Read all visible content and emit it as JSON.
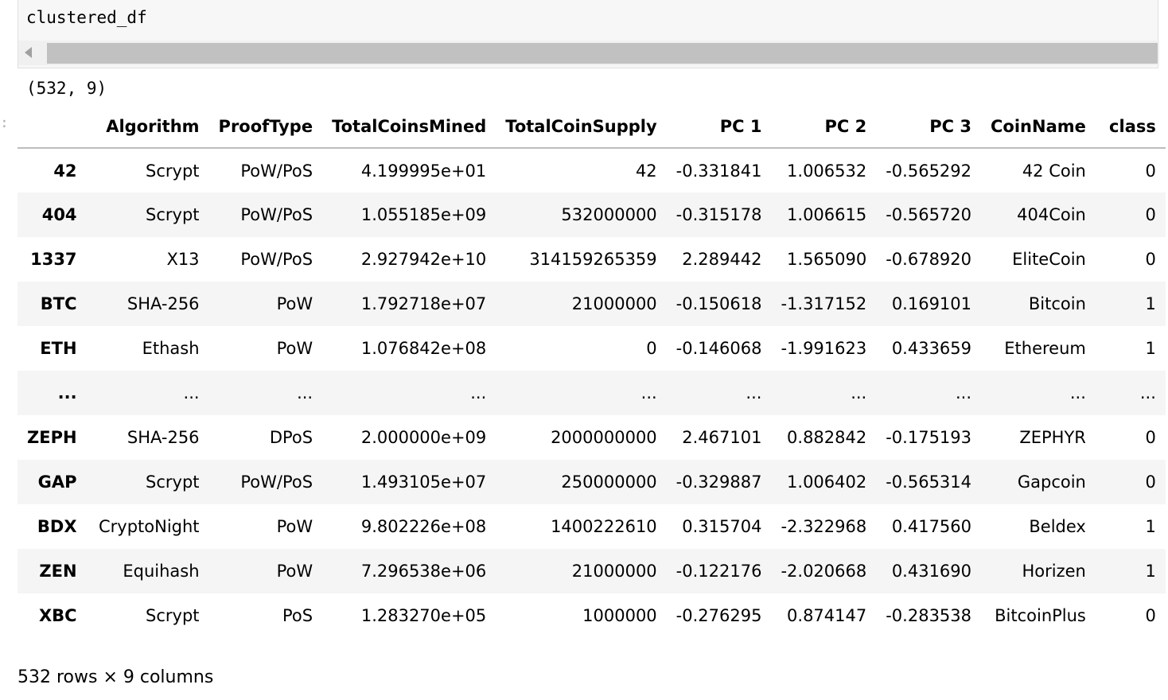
{
  "code_cell": {
    "code": "clustered_df"
  },
  "output": {
    "shape_text": "(532, 9)",
    "prompt_marker": ":"
  },
  "table": {
    "index_header": "",
    "columns": [
      "Algorithm",
      "ProofType",
      "TotalCoinsMined",
      "TotalCoinSupply",
      "PC 1",
      "PC 2",
      "PC 3",
      "CoinName",
      "class"
    ],
    "rows": [
      {
        "index": "42",
        "cells": [
          "Scrypt",
          "PoW/PoS",
          "4.199995e+01",
          "42",
          "-0.331841",
          "1.006532",
          "-0.565292",
          "42 Coin",
          "0"
        ]
      },
      {
        "index": "404",
        "cells": [
          "Scrypt",
          "PoW/PoS",
          "1.055185e+09",
          "532000000",
          "-0.315178",
          "1.006615",
          "-0.565720",
          "404Coin",
          "0"
        ]
      },
      {
        "index": "1337",
        "cells": [
          "X13",
          "PoW/PoS",
          "2.927942e+10",
          "314159265359",
          "2.289442",
          "1.565090",
          "-0.678920",
          "EliteCoin",
          "0"
        ]
      },
      {
        "index": "BTC",
        "cells": [
          "SHA-256",
          "PoW",
          "1.792718e+07",
          "21000000",
          "-0.150618",
          "-1.317152",
          "0.169101",
          "Bitcoin",
          "1"
        ]
      },
      {
        "index": "ETH",
        "cells": [
          "Ethash",
          "PoW",
          "1.076842e+08",
          "0",
          "-0.146068",
          "-1.991623",
          "0.433659",
          "Ethereum",
          "1"
        ]
      },
      {
        "index": "...",
        "cells": [
          "...",
          "...",
          "...",
          "...",
          "...",
          "...",
          "...",
          "...",
          "..."
        ]
      },
      {
        "index": "ZEPH",
        "cells": [
          "SHA-256",
          "DPoS",
          "2.000000e+09",
          "2000000000",
          "2.467101",
          "0.882842",
          "-0.175193",
          "ZEPHYR",
          "0"
        ]
      },
      {
        "index": "GAP",
        "cells": [
          "Scrypt",
          "PoW/PoS",
          "1.493105e+07",
          "250000000",
          "-0.329887",
          "1.006402",
          "-0.565314",
          "Gapcoin",
          "0"
        ]
      },
      {
        "index": "BDX",
        "cells": [
          "CryptoNight",
          "PoW",
          "9.802226e+08",
          "1400222610",
          "0.315704",
          "-2.322968",
          "0.417560",
          "Beldex",
          "1"
        ]
      },
      {
        "index": "ZEN",
        "cells": [
          "Equihash",
          "PoW",
          "7.296538e+06",
          "21000000",
          "-0.122176",
          "-2.020668",
          "0.431690",
          "Horizen",
          "1"
        ]
      },
      {
        "index": "XBC",
        "cells": [
          "Scrypt",
          "PoS",
          "1.283270e+05",
          "1000000",
          "-0.276295",
          "0.874147",
          "-0.283538",
          "BitcoinPlus",
          "0"
        ]
      }
    ]
  },
  "summary": "532 rows × 9 columns"
}
